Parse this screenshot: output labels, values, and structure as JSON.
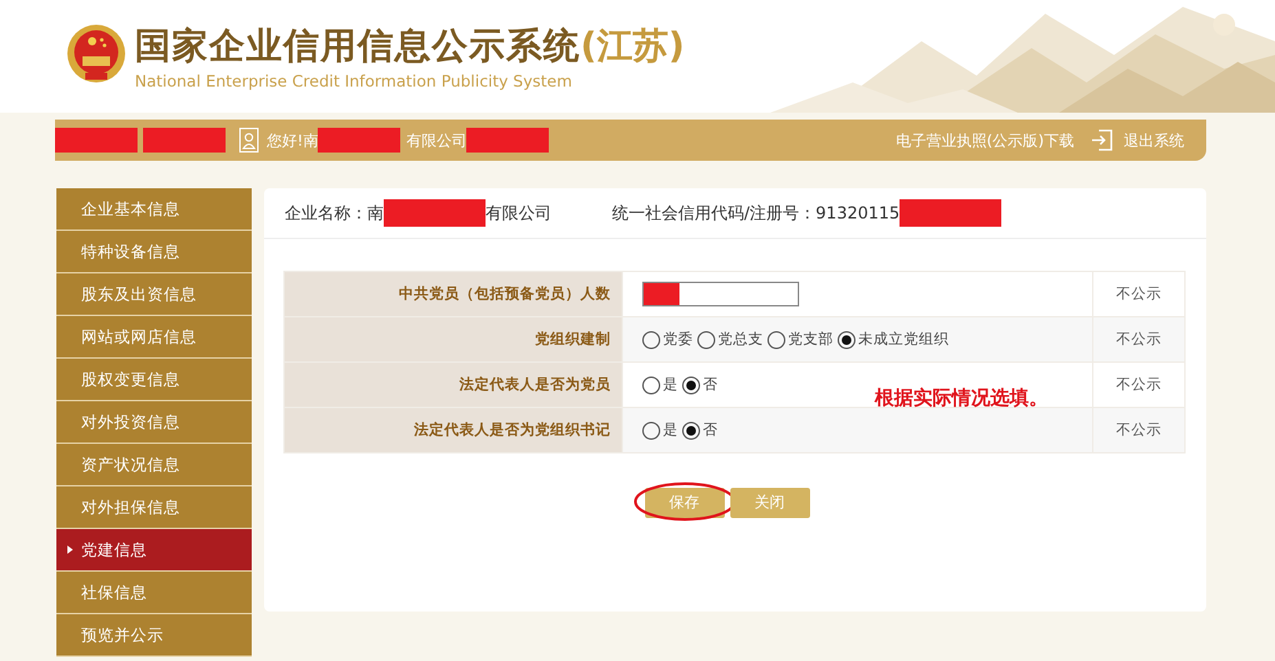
{
  "header": {
    "title": "国家企业信用信息公示系统",
    "region": "(江苏)",
    "subtitle": "National Enterprise Credit Information Publicity System"
  },
  "top_bar": {
    "left": [
      {
        "kind": "redacted"
      },
      {
        "kind": "redacted"
      },
      {
        "kind": "user"
      },
      {
        "kind": "text",
        "text": "您好!南"
      },
      {
        "kind": "redacted"
      },
      {
        "kind": "text",
        "text": "有限公司"
      },
      {
        "kind": "redacted"
      }
    ],
    "links": [
      {
        "kind": "text",
        "label": "电子营业执照(公示版)下载"
      },
      {
        "kind": "exit",
        "label": "退出系统"
      }
    ]
  },
  "sidebar": {
    "items": [
      {
        "label": "企业基本信息",
        "selected": false
      },
      {
        "label": "特种设备信息",
        "selected": false
      },
      {
        "label": "股东及出资信息",
        "selected": false
      },
      {
        "label": "网站或网店信息",
        "selected": false
      },
      {
        "label": "股权变更信息",
        "selected": false
      },
      {
        "label": "对外投资信息",
        "selected": false
      },
      {
        "label": "资产状况信息",
        "selected": false
      },
      {
        "label": "对外担保信息",
        "selected": false
      },
      {
        "label": "党建信息",
        "selected": true
      },
      {
        "label": "社保信息",
        "selected": false
      },
      {
        "label": "预览并公示",
        "selected": false
      }
    ]
  },
  "company": [
    {
      "label": "企业名称：",
      "value": [
        {
          "kind": "text",
          "text": "南"
        },
        {
          "kind": "redacted"
        },
        {
          "kind": "text",
          "text": "有限公司"
        }
      ]
    },
    {
      "label": "统一社会信用代码/注册号：",
      "value": [
        {
          "kind": "text",
          "text": "91320115"
        },
        {
          "kind": "redacted"
        }
      ]
    }
  ],
  "form": {
    "rows": [
      {
        "label": "中共党员（包括预备党员）人数",
        "kind": "input",
        "redacted": true,
        "visibility": "不公示"
      },
      {
        "label": "党组织建制",
        "kind": "radio",
        "options": [
          {
            "label": "党委",
            "selected": false
          },
          {
            "label": "党总支",
            "selected": false
          },
          {
            "label": "党支部",
            "selected": false
          },
          {
            "label": "未成立党组织",
            "selected": true
          }
        ],
        "visibility": "不公示"
      },
      {
        "label": "法定代表人是否为党员",
        "kind": "radio",
        "options": [
          {
            "label": "是",
            "selected": false
          },
          {
            "label": "否",
            "selected": true
          }
        ],
        "visibility": "不公示"
      },
      {
        "label": "法定代表人是否为党组织书记",
        "kind": "radio",
        "options": [
          {
            "label": "是",
            "selected": false
          },
          {
            "label": "否",
            "selected": true
          }
        ],
        "visibility": "不公示"
      }
    ]
  },
  "note": "根据实际情况选填。",
  "buttons": [
    {
      "label": "保存",
      "circled": true
    },
    {
      "label": "关闭",
      "circled": false
    }
  ]
}
